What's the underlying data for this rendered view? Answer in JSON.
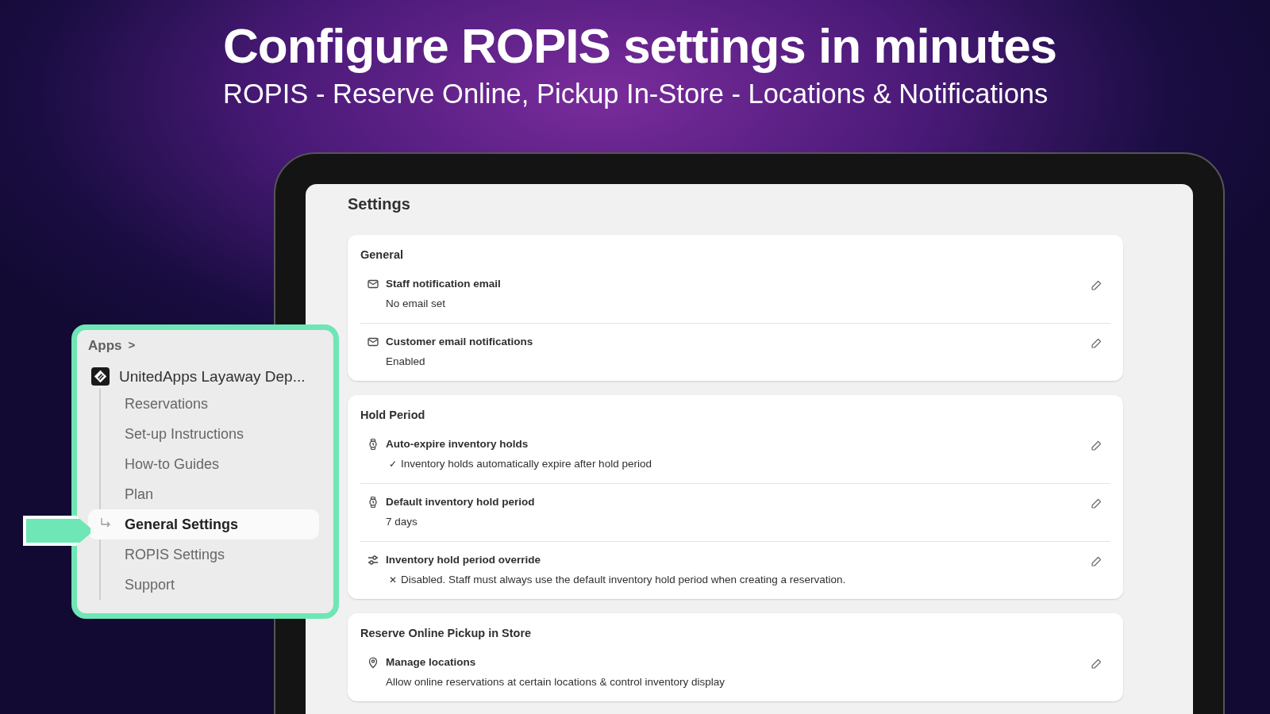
{
  "headline": "Configure ROPIS settings in minutes",
  "subheadline": "ROPIS - Reserve Online, Pickup In-Store - Locations & Notifications",
  "sidebar": {
    "breadcrumb": "Apps",
    "breadcrumb_chevron": ">",
    "app_name": "UnitedApps Layaway Dep...",
    "items": [
      {
        "label": "Reservations",
        "selected": false
      },
      {
        "label": "Set-up Instructions",
        "selected": false
      },
      {
        "label": "How-to Guides",
        "selected": false
      },
      {
        "label": "Plan",
        "selected": false
      },
      {
        "label": "General Settings",
        "selected": true
      },
      {
        "label": "ROPIS Settings",
        "selected": false
      },
      {
        "label": "Support",
        "selected": false
      }
    ]
  },
  "settings": {
    "title": "Settings",
    "sections": [
      {
        "title": "General",
        "rows": [
          {
            "kind": "mail",
            "title": "Staff notification email",
            "detail": "No email set"
          },
          {
            "kind": "mail",
            "title": "Customer email notifications",
            "detail": "Enabled"
          }
        ]
      },
      {
        "title": "Hold Period",
        "rows": [
          {
            "kind": "watch",
            "title": "Auto-expire inventory holds",
            "detail_mark": "✓",
            "detail": "Inventory holds automatically expire after hold period"
          },
          {
            "kind": "watch",
            "title": "Default inventory hold period",
            "detail": "7 days"
          },
          {
            "kind": "sliders",
            "title": "Inventory hold period override",
            "detail_mark": "✕",
            "detail": "Disabled. Staff must always use the default inventory hold period when creating a reservation."
          }
        ]
      },
      {
        "title": "Reserve Online Pickup in Store",
        "rows": [
          {
            "kind": "pin",
            "title": "Manage locations",
            "detail": "Allow online reservations at certain locations & control inventory display"
          }
        ]
      }
    ]
  }
}
